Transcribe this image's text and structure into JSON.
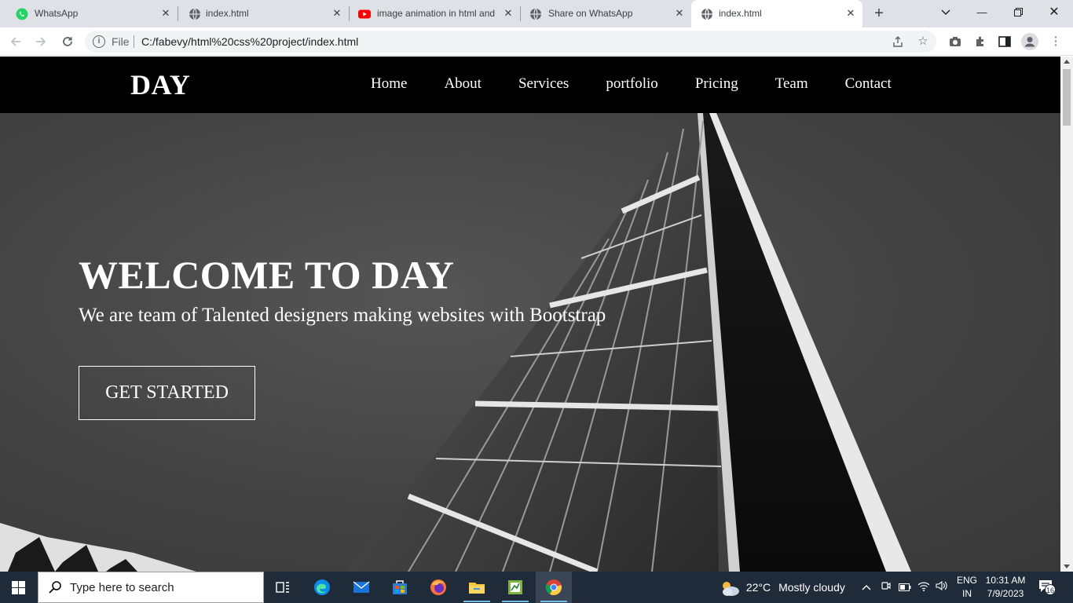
{
  "browser": {
    "tabs": [
      {
        "title": "WhatsApp",
        "favicon": "whatsapp-icon",
        "active": false
      },
      {
        "title": "index.html",
        "favicon": "globe-icon",
        "active": false
      },
      {
        "title": "image animation in html and",
        "favicon": "youtube-icon",
        "active": false
      },
      {
        "title": "Share on WhatsApp",
        "favicon": "globe-icon",
        "active": false
      },
      {
        "title": "index.html",
        "favicon": "globe-icon",
        "active": true
      }
    ],
    "address": {
      "scheme": "File",
      "url": "C:/fabevy/html%20css%20project/index.html"
    }
  },
  "site": {
    "brand": "DAY",
    "nav": [
      "Home",
      "About",
      "Services",
      "portfolio",
      "Pricing",
      "Team",
      "Contact"
    ],
    "hero": {
      "title": "WELCOME TO DAY",
      "subtitle": "We are team of Talented designers making websites with Bootstrap",
      "cta": "GET STARTED"
    }
  },
  "taskbar": {
    "search_placeholder": "Type here to search",
    "weather_temp": "22°C",
    "weather_text": "Mostly cloudy",
    "lang_top": "ENG",
    "lang_bottom": "IN",
    "time": "10:31 AM",
    "date": "7/9/2023",
    "notification_count": "16"
  },
  "colors": {
    "nav_bg": "#000000",
    "hero_bg": "#444444",
    "text": "#ffffff",
    "taskbar_bg": "#202b3a"
  }
}
